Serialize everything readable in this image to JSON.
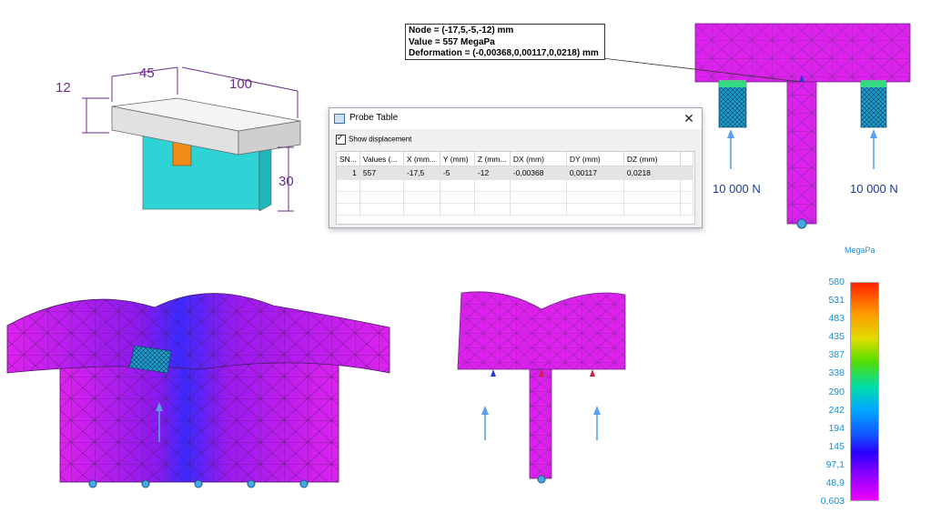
{
  "sketch": {
    "dim_top_left": "45",
    "dim_top_right": "100",
    "dim_left": "12",
    "dim_right": "30"
  },
  "tooltip": {
    "line1": "Node = (-17,5,-5,-12) mm",
    "line2": "Value = 557 MegaPa",
    "line3": "Deformation = (-0,00368,0,00117,0,0218) mm"
  },
  "probe_table": {
    "title": "Probe Table",
    "close_symbol": "✕",
    "show_displacement_label": "Show displacement",
    "show_displacement_checked": true,
    "columns": [
      "SN...",
      "Values (...",
      "X (mm...",
      "Y (mm)",
      "Z (mm...",
      "DX (mm)",
      "DY (mm)",
      "DZ (mm)"
    ],
    "rows": [
      [
        "1",
        "557",
        "-17,5",
        "-5",
        "-12",
        "-0,00368",
        "0,00117",
        "0,0218"
      ]
    ]
  },
  "forces": {
    "left_label": "10 000 N",
    "right_label": "10 000 N"
  },
  "legend": {
    "unit": "MegaPa",
    "values": [
      "580",
      "531",
      "483",
      "435",
      "387",
      "338",
      "290",
      "242",
      "194",
      "145",
      "97,1",
      "48,9",
      "0,603"
    ],
    "max_color": "#ff2200",
    "min_color": "#ee00ff"
  },
  "colors": {
    "mesh_magenta": "#dd22ee",
    "mesh_line": "#6a2a80",
    "force_blue": "#1f3a9c",
    "legend_text": "#1a8fd0"
  }
}
